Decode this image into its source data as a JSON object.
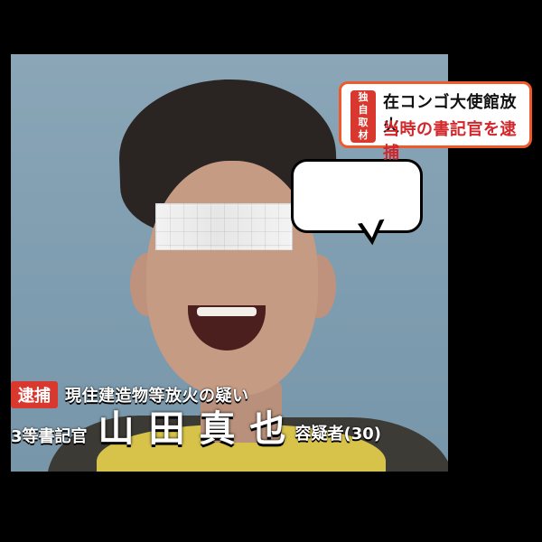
{
  "headline": {
    "tag_text": "独\n自\n取\n材",
    "line1": "在コンゴ大使館放火",
    "line2": "当時の書記官を逮捕"
  },
  "caption": {
    "badge": "逮捕",
    "charge": "現住建造物等放火の疑い",
    "position": "3等書記官",
    "name": "山田真也",
    "suffix": "容疑者(30)"
  },
  "colors": {
    "accent_red": "#d9382e",
    "orange_border": "#f05a2a",
    "background_black": "#000000"
  }
}
